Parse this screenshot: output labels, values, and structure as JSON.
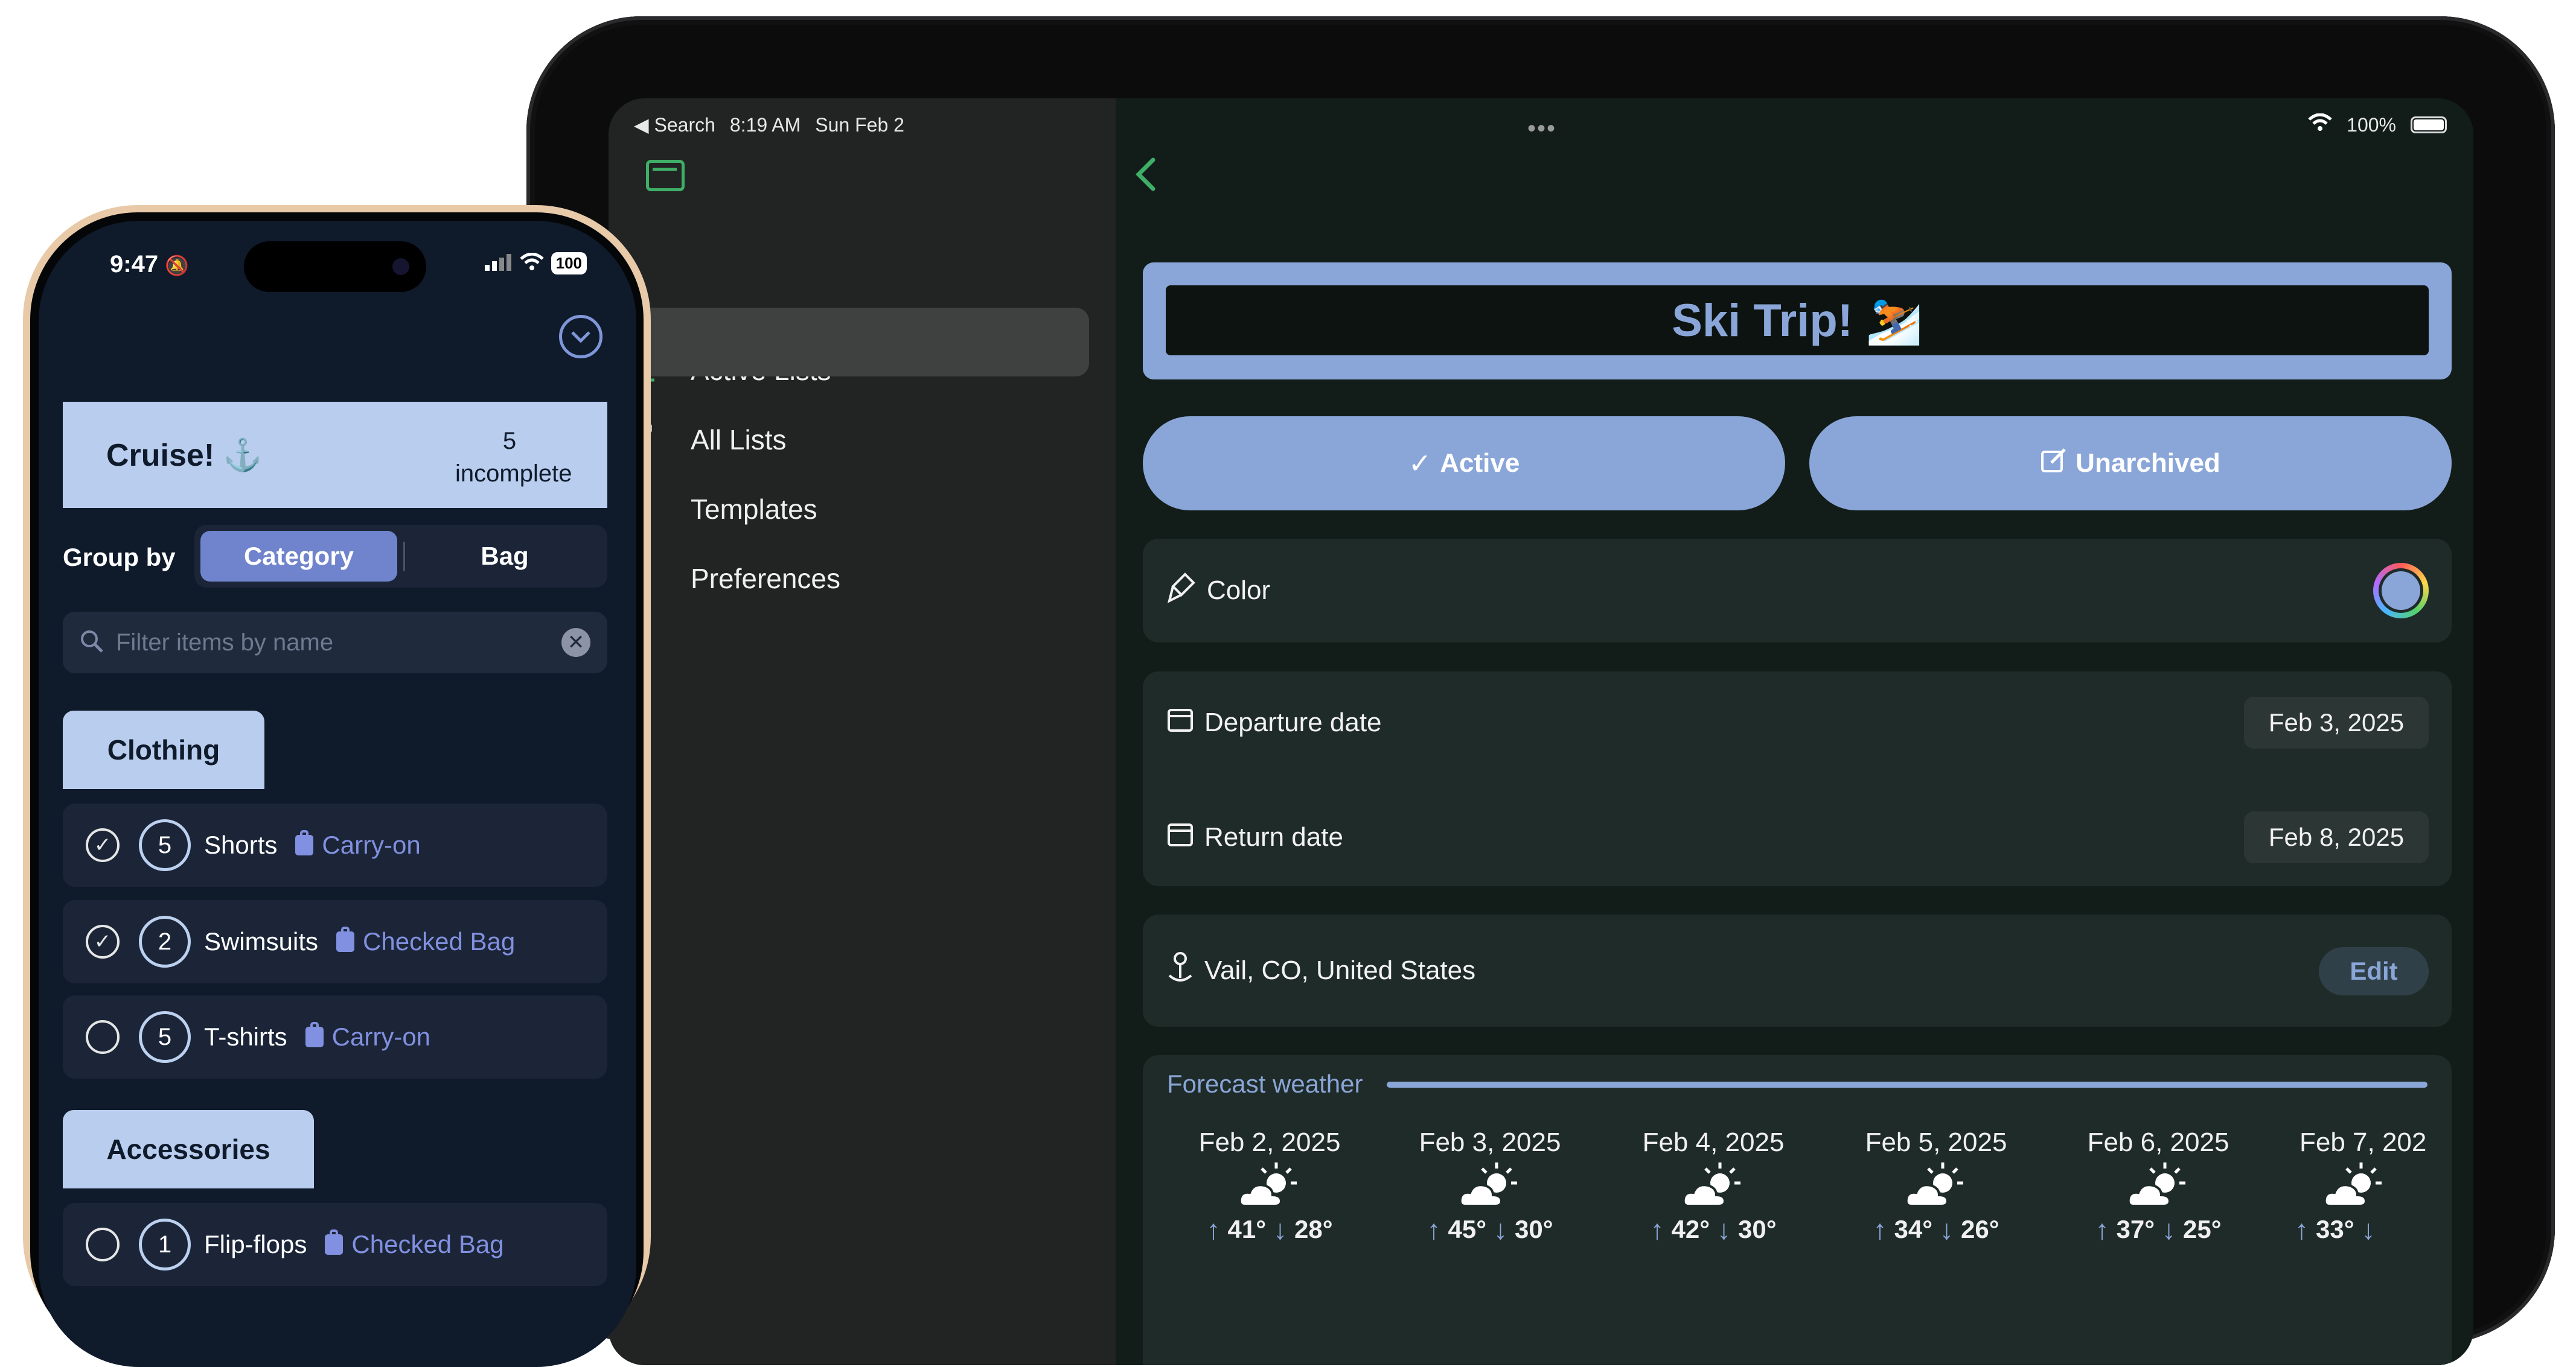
{
  "ipad": {
    "status": {
      "back_app": "◀ Search",
      "time": "8:19 AM",
      "date": "Sun Feb 2",
      "battery": "100%"
    },
    "sidebar": {
      "items": [
        {
          "label": "Active Lists",
          "icon": "checklist-icon"
        },
        {
          "label": "All Lists",
          "icon": "archivebox-icon",
          "selected": true
        },
        {
          "label": "Templates",
          "icon": "bookmark-icon"
        },
        {
          "label": "Preferences",
          "icon": "person-icon"
        }
      ]
    },
    "detail": {
      "title": "Ski Trip! ⛷️",
      "active_label": "Active",
      "unarchived_label": "Unarchived",
      "color_label": "Color",
      "departure_label": "Departure date",
      "departure_value": "Feb 3, 2025",
      "return_label": "Return date",
      "return_value": "Feb 8, 2025",
      "location": "Vail, CO, United States",
      "edit_label": "Edit",
      "forecast_label": "Forecast weather",
      "forecast": [
        {
          "date": "Feb 2, 2025",
          "high": "41°",
          "low": "28°"
        },
        {
          "date": "Feb 3, 2025",
          "high": "45°",
          "low": "30°"
        },
        {
          "date": "Feb 4, 2025",
          "high": "42°",
          "low": "30°"
        },
        {
          "date": "Feb 5, 2025",
          "high": "34°",
          "low": "26°"
        },
        {
          "date": "Feb 6, 2025",
          "high": "37°",
          "low": "25°"
        },
        {
          "date": "Feb 7, 202",
          "high": "33°",
          "low": ""
        }
      ]
    },
    "colors": {
      "accent_green": "#3fae66",
      "accent_blue": "#8aa6d8"
    }
  },
  "iphone": {
    "status": {
      "time": "9:47",
      "battery": "100"
    },
    "list_title": "Cruise! ⚓️",
    "incomplete_count": "5",
    "incomplete_label": "incomplete",
    "group_by_label": "Group by",
    "segments": [
      "Category",
      "Bag"
    ],
    "filter_placeholder": "Filter items by name",
    "sections": [
      {
        "name": "Clothing",
        "items": [
          {
            "qty": "5",
            "name": "Shorts",
            "bag": "Carry-on",
            "checked": true
          },
          {
            "qty": "2",
            "name": "Swimsuits",
            "bag": "Checked Bag",
            "checked": true
          },
          {
            "qty": "5",
            "name": "T-shirts",
            "bag": "Carry-on",
            "checked": false
          }
        ]
      },
      {
        "name": "Accessories",
        "items": [
          {
            "qty": "1",
            "name": "Flip-flops",
            "bag": "Checked Bag",
            "checked": false
          }
        ]
      }
    ]
  }
}
